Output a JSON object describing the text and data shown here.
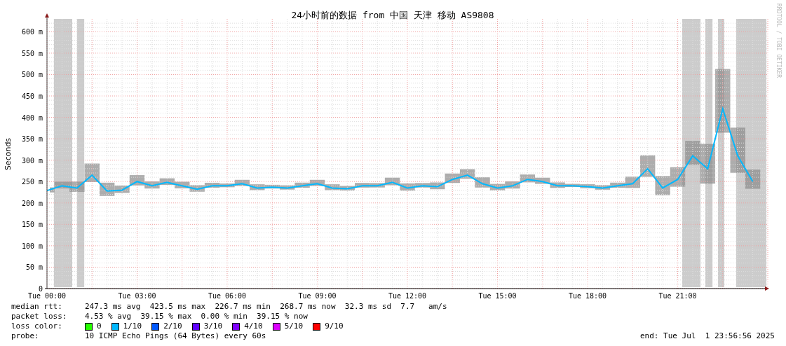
{
  "graph": {
    "title": "24小时前的数据 from 中国 天津 移动 AS9808",
    "credit": "RRDTOOL / TOBI OETIKER",
    "chart_data": {
      "type": "line",
      "ylabel": "Seconds",
      "categories": [
        "Tue 00:00",
        null,
        null,
        null,
        null,
        null,
        "Tue 03:00",
        null,
        null,
        null,
        null,
        null,
        "Tue 06:00",
        null,
        null,
        null,
        null,
        null,
        "Tue 09:00",
        null,
        null,
        null,
        null,
        null,
        "Tue 12:00",
        null,
        null,
        null,
        null,
        null,
        "Tue 15:00",
        null,
        null,
        null,
        null,
        null,
        "Tue 18:00",
        null,
        null,
        null,
        null,
        null,
        "Tue 21:00",
        null,
        null,
        null,
        null,
        null
      ],
      "values": [
        229,
        240,
        235,
        265,
        228,
        230,
        250,
        240,
        248,
        240,
        232,
        240,
        240,
        245,
        235,
        237,
        235,
        240,
        245,
        235,
        233,
        240,
        240,
        248,
        235,
        240,
        238,
        255,
        265,
        245,
        235,
        240,
        255,
        250,
        240,
        240,
        238,
        235,
        240,
        245,
        280,
        235,
        255,
        310,
        280,
        420,
        310,
        250
      ],
      "ylim": [
        0,
        630
      ],
      "yticks": [
        {
          "value": 0,
          "label": "0"
        },
        {
          "value": 50,
          "label": "50 m"
        },
        {
          "value": 100,
          "label": "100 m"
        },
        {
          "value": 150,
          "label": "150 m"
        },
        {
          "value": 200,
          "label": "200 m"
        },
        {
          "value": 250,
          "label": "250 m"
        },
        {
          "value": 300,
          "label": "300 m"
        },
        {
          "value": 350,
          "label": "350 m"
        },
        {
          "value": 400,
          "label": "400 m"
        },
        {
          "value": 450,
          "label": "450 m"
        },
        {
          "value": 500,
          "label": "500 m"
        },
        {
          "value": 550,
          "label": "550 m"
        },
        {
          "value": 600,
          "label": "600 m"
        }
      ],
      "grid": true
    }
  },
  "stats": [
    {
      "label": "median rtt:",
      "text": "247.3 ms avg  423.5 ms max  226.7 ms min  268.7 ms now  32.3 ms sd  7.7   am/s"
    },
    {
      "label": "packet loss:",
      "text": "4.53 % avg  39.15 % max  0.00 % min  39.15 % now"
    }
  ],
  "loss_color": {
    "label": "loss color:",
    "items": [
      {
        "label": "0",
        "color": "#26ff00"
      },
      {
        "label": "1/10",
        "color": "#00b8ff"
      },
      {
        "label": "2/10",
        "color": "#0059ff"
      },
      {
        "label": "3/10",
        "color": "#5e00ff"
      },
      {
        "label": "4/10",
        "color": "#7e00ff"
      },
      {
        "label": "5/10",
        "color": "#dd00ff"
      },
      {
        "label": "9/10",
        "color": "#ff0000"
      }
    ]
  },
  "probe": {
    "label": "probe:",
    "text": "10 ICMP Echo Pings (64 Bytes) every 60s"
  },
  "end": "end: Tue Jul  1 23:56:56 2025"
}
